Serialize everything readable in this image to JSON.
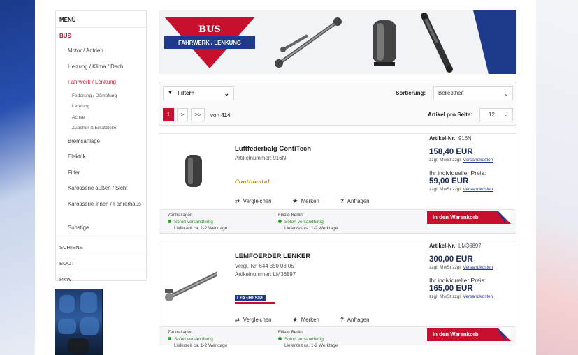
{
  "sidebar": {
    "title": "MENÜ",
    "section": "BUS",
    "items": [
      {
        "label": "Motor / Antrieb"
      },
      {
        "label": "Heizung / Klima / Dach"
      },
      {
        "label": "Fahrwerk / Lenkung"
      }
    ],
    "subitems": [
      {
        "label": "Federung / Dämpfung"
      },
      {
        "label": "Lenkung"
      },
      {
        "label": "Achse"
      },
      {
        "label": "Zubehör & Ersatzteile"
      }
    ],
    "items2": [
      {
        "label": "Bremsanlage"
      },
      {
        "label": "Elektrik"
      },
      {
        "label": "Filter"
      },
      {
        "label": "Karosserie außen / Sicht"
      },
      {
        "label": "Karosserie innen / Fahrerhaus"
      },
      {
        "label": "Sonstige"
      }
    ],
    "categories": [
      {
        "label": "SCHIENE"
      },
      {
        "label": "BOOT"
      },
      {
        "label": "PKW"
      }
    ]
  },
  "hero": {
    "title": "BUS",
    "subtitle": "FAHRWERK / LENKUNG"
  },
  "toolbar": {
    "filter_label": "Filtern",
    "sort_label": "Sortierung:",
    "sort_value": "Beliebtheit",
    "page_current": "1",
    "next": ">",
    "last": ">>",
    "of_label": "von",
    "total_pages": "414",
    "per_page_label": "Artikel pro Seite:",
    "per_page_value": "12"
  },
  "products": [
    {
      "name": "Luftfederbalg ContiTech",
      "meta1": "Artikelnummer: 916N",
      "meta2": "",
      "brand": "Continental",
      "art_label": "Artikel-Nr.:",
      "art_nr": "916N",
      "price": "158,40 EUR",
      "vat": "zzgl. MwSt zzgl.",
      "shipping": "Versandkosten",
      "ind_label": "Ihr individueller Preis:",
      "ind_price": "59,00 EUR",
      "compare": "Vergleichen",
      "remember": "Merken",
      "inquire": "Anfragen",
      "store1": "Zentrallager:",
      "store2": "Filiale Berlin:",
      "stock_status": "Sofort versandfertig",
      "delivery": "Lieferzeit ca. 1-2 Werktage",
      "cart": "In den Warenkorb"
    },
    {
      "name": "LEMFOERDER LENKER",
      "meta1": "Vergl.-Nr. 644 350 03 05",
      "meta2": "Artikelnummer: LM36897",
      "brand": "LEX+HESSE",
      "art_label": "Artikel-Nr.:",
      "art_nr": "LM36897",
      "price": "300,00 EUR",
      "vat": "zzgl. MwSt zzgl.",
      "shipping": "Versandkosten",
      "ind_label": "Ihr individueller Preis:",
      "ind_price": "165,00 EUR",
      "compare": "Vergleichen",
      "remember": "Merken",
      "inquire": "Anfragen",
      "store1": "Zentrallager:",
      "store2": "Filiale Berlin:",
      "stock_status": "Sofort versandfertig",
      "delivery": "Lieferzeit ca. 1-2 Werktage",
      "cart": "In den Warenkorb"
    }
  ],
  "colors": {
    "accent": "#c8102e",
    "navy": "#1e3a8a",
    "stock_green": "#2ca02c"
  }
}
